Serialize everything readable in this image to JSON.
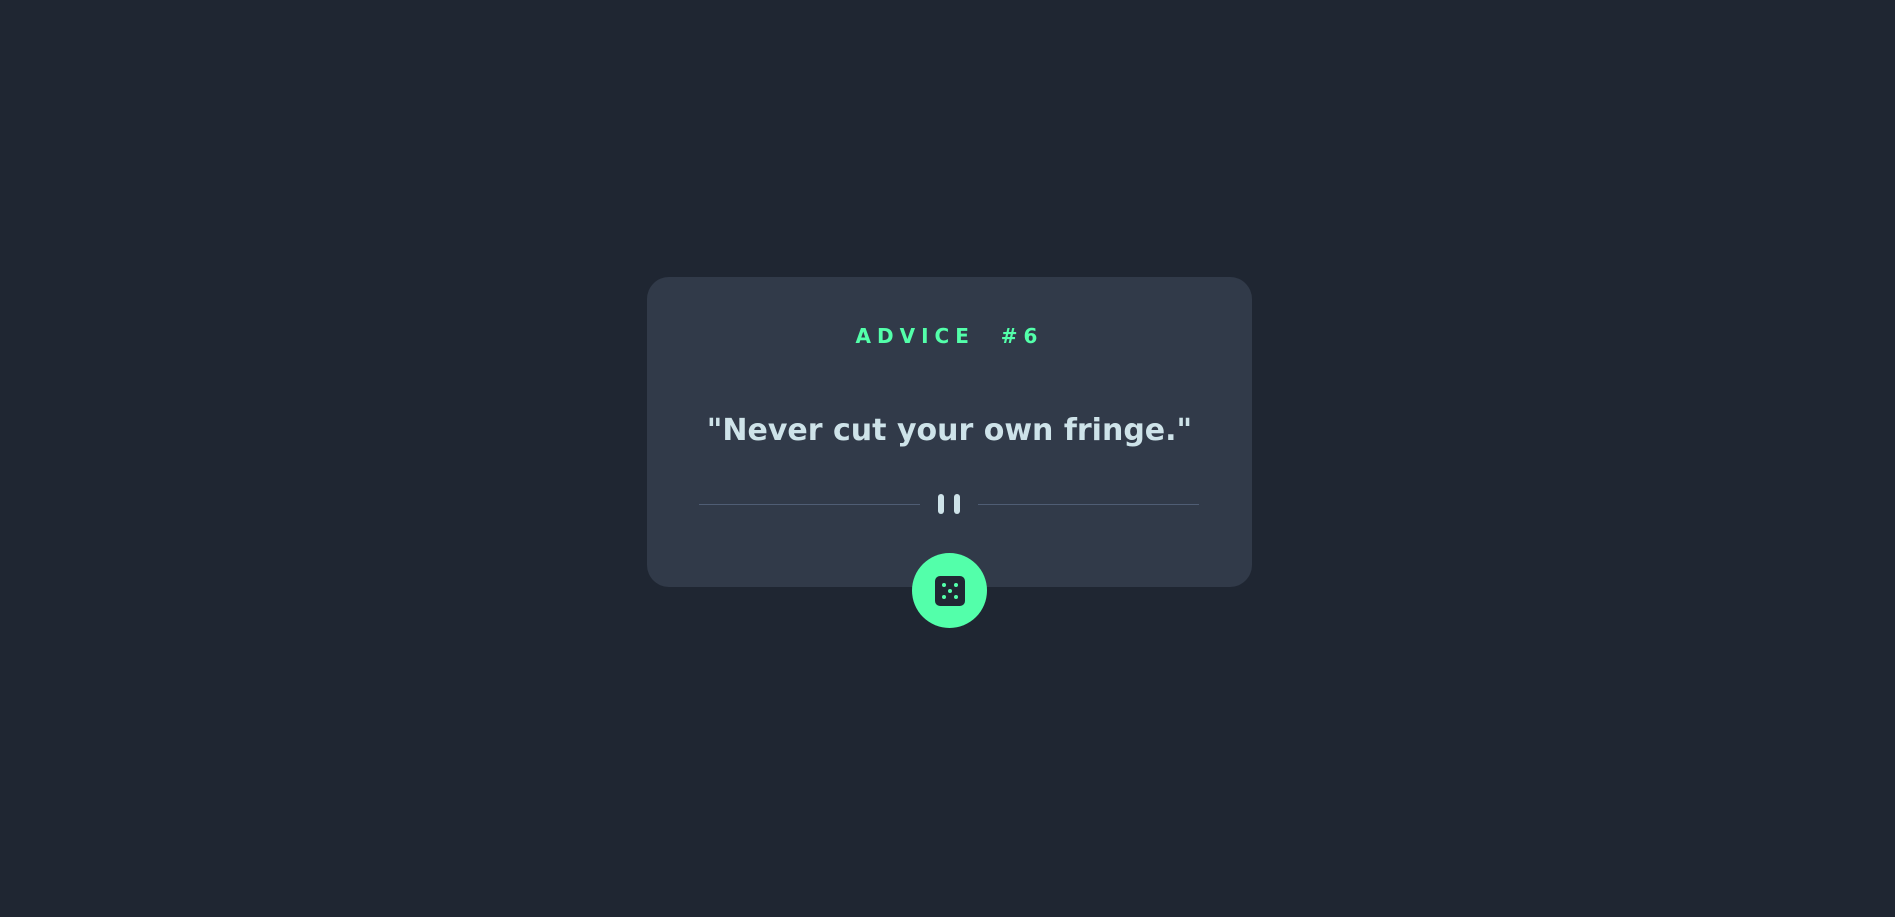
{
  "advice": {
    "label": "ADVICE  #6",
    "quote": "\"Never cut your own fringe.\""
  },
  "divider": {
    "icon": "pause-icon"
  },
  "button": {
    "icon": "dice-icon",
    "aria_label": "Generate new advice"
  },
  "colors": {
    "background": "#1f2632",
    "card": "#313a49",
    "accent": "#53ffaa",
    "text": "#cee3e9",
    "divider": "#4f5d74"
  }
}
